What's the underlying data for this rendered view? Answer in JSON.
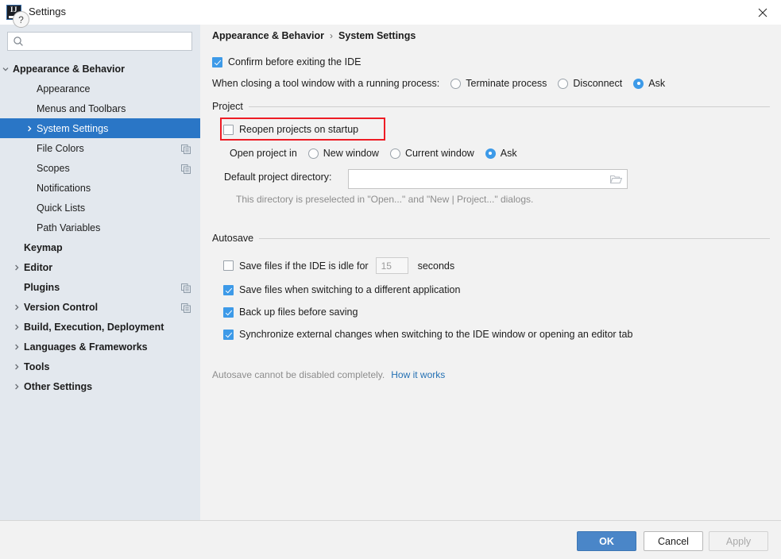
{
  "window": {
    "title": "Settings",
    "logo_icon": "intellij-idea-logo",
    "close_icon": "close-icon"
  },
  "search": {
    "placeholder": "",
    "value": "",
    "icon": "search-icon"
  },
  "sidebar": {
    "items": [
      {
        "label": "Appearance & Behavior",
        "indent": 16,
        "chevron": "down",
        "bold": true,
        "selected": false,
        "badge": false
      },
      {
        "label": "Appearance",
        "indent": 46,
        "chevron": "none",
        "bold": false,
        "selected": false,
        "badge": false
      },
      {
        "label": "Menus and Toolbars",
        "indent": 46,
        "chevron": "none",
        "bold": false,
        "selected": false,
        "badge": false
      },
      {
        "label": "System Settings",
        "indent": 46,
        "chevron": "right",
        "bold": false,
        "selected": true,
        "badge": false
      },
      {
        "label": "File Colors",
        "indent": 46,
        "chevron": "none",
        "bold": false,
        "selected": false,
        "badge": true
      },
      {
        "label": "Scopes",
        "indent": 46,
        "chevron": "none",
        "bold": false,
        "selected": false,
        "badge": true
      },
      {
        "label": "Notifications",
        "indent": 46,
        "chevron": "none",
        "bold": false,
        "selected": false,
        "badge": false
      },
      {
        "label": "Quick Lists",
        "indent": 46,
        "chevron": "none",
        "bold": false,
        "selected": false,
        "badge": false
      },
      {
        "label": "Path Variables",
        "indent": 46,
        "chevron": "none",
        "bold": false,
        "selected": false,
        "badge": false
      },
      {
        "label": "Keymap",
        "indent": 30,
        "chevron": "none",
        "bold": true,
        "selected": false,
        "badge": false
      },
      {
        "label": "Editor",
        "indent": 30,
        "chevron": "right",
        "bold": true,
        "selected": false,
        "badge": false
      },
      {
        "label": "Plugins",
        "indent": 30,
        "chevron": "none",
        "bold": true,
        "selected": false,
        "badge": true
      },
      {
        "label": "Version Control",
        "indent": 30,
        "chevron": "right",
        "bold": true,
        "selected": false,
        "badge": true
      },
      {
        "label": "Build, Execution, Deployment",
        "indent": 30,
        "chevron": "right",
        "bold": true,
        "selected": false,
        "badge": false
      },
      {
        "label": "Languages & Frameworks",
        "indent": 30,
        "chevron": "right",
        "bold": true,
        "selected": false,
        "badge": false
      },
      {
        "label": "Tools",
        "indent": 30,
        "chevron": "right",
        "bold": true,
        "selected": false,
        "badge": false
      },
      {
        "label": "Other Settings",
        "indent": 30,
        "chevron": "right",
        "bold": true,
        "selected": false,
        "badge": false
      }
    ]
  },
  "breadcrumb": {
    "parent": "Appearance & Behavior",
    "separator": "›",
    "current": "System Settings"
  },
  "main": {
    "confirm_exit": {
      "label": "Confirm before exiting the IDE",
      "checked": true
    },
    "tool_window_close": {
      "label": "When closing a tool window with a running process:",
      "options": [
        {
          "label": "Terminate process",
          "selected": false
        },
        {
          "label": "Disconnect",
          "selected": false
        },
        {
          "label": "Ask",
          "selected": true
        }
      ]
    },
    "project_group": {
      "title": "Project",
      "reopen": {
        "label": "Reopen projects on startup",
        "checked": false,
        "highlighted": true
      },
      "open_project_in": {
        "label": "Open project in",
        "options": [
          {
            "label": "New window",
            "selected": false
          },
          {
            "label": "Current window",
            "selected": false
          },
          {
            "label": "Ask",
            "selected": true
          }
        ]
      },
      "default_dir": {
        "label": "Default project directory:",
        "value": "",
        "placeholder": "",
        "browse_icon": "folder-icon"
      },
      "dir_hint": "This directory is preselected in \"Open...\" and \"New | Project...\" dialogs."
    },
    "autosave_group": {
      "title": "Autosave",
      "idle": {
        "label_before": "Save files if the IDE is idle for",
        "value": "15",
        "label_after": "seconds",
        "checked": false,
        "enabled": false
      },
      "checkboxes": [
        {
          "label": "Save files when switching to a different application",
          "checked": true
        },
        {
          "label": "Back up files before saving",
          "checked": true
        },
        {
          "label": "Synchronize external changes when switching to the IDE window or opening an editor tab",
          "checked": true
        }
      ],
      "note": "Autosave cannot be disabled completely.",
      "note_link": "How it works"
    }
  },
  "footer": {
    "help_label": "?",
    "ok": "OK",
    "cancel": "Cancel",
    "apply": "Apply"
  },
  "colors": {
    "accent_blue": "#3d9ae8",
    "selection_blue": "#2a76c6",
    "button_blue": "#4a86c8",
    "link_blue": "#2470b3",
    "annotation_red": "#ee1c25",
    "sidebar_bg": "#e3e8ee",
    "panel_bg": "#f2f2f2"
  }
}
